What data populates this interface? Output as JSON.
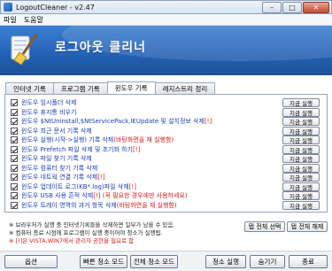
{
  "window": {
    "title": "LogoutCleaner - v2.47"
  },
  "menu": {
    "file": "파일",
    "help": "도움말"
  },
  "banner": {
    "title": "로그아웃 클리너",
    "subtitle": ""
  },
  "tabs": [
    "인터넷 기록",
    "프로그램 기록",
    "윈도우 기록",
    "레지스트리 정리"
  ],
  "rows": [
    {
      "label": "윈도우 임시폴더 삭제",
      "note": "",
      "run": "지금 실행"
    },
    {
      "label": "윈도우 휴지통 비우기",
      "note": "",
      "run": "지금 실행"
    },
    {
      "label": "윈도우 $NtUninstall,$NtServicePack,IEUpdate 및 설치정보 삭제",
      "note": "[!]",
      "run": "지금 실행"
    },
    {
      "label": "윈도우 최근 문서 기록 삭제",
      "note": "",
      "run": "지금 실행"
    },
    {
      "label": "윈도우 실행(시작->실행) 기록 삭제",
      "note": "(바탕화면을 재 실행함)",
      "run": "지금 실행"
    },
    {
      "label": "윈도우 Prefetch 파일 삭제 및 초기화 하기",
      "note": "[!]",
      "run": "지금 실행"
    },
    {
      "label": "윈도우 파일 찾기 기록 삭제",
      "note": "",
      "run": "지금 실행"
    },
    {
      "label": "윈도우 컴퓨터 찾기 기록 삭제",
      "note": "",
      "run": "지금 실행"
    },
    {
      "label": "윈도우 네트웍 연결 기록 삭제",
      "note": "[!]",
      "run": "지금 실행"
    },
    {
      "label": "윈도우 업데이트 로그(KB*.log)파일 삭제",
      "note": "[!]",
      "run": "지금 실행"
    },
    {
      "label": "윈도우 USB 사용 흔적 삭제",
      "note": "[!] (꼭 필요한 경우에만 사용하세요)",
      "run": "지금 실행"
    },
    {
      "label": "윈도우 트레이 영역의 과거 항목 삭제",
      "note": "(바탕화면을 재 실행함)",
      "run": "지금 실행"
    }
  ],
  "notes": [
    "※ 브라우저가 실행 중 인터넷기록들을 삭제하면 일부가 남을 수 있음.",
    "※ 컴퓨터 종료 시점에 프로그램이 실행 중이어야 청소가 실행됨.",
    "※ [!]은 VISTA,WIN7에서 관리자 권한을 필요로 함"
  ],
  "select_buttons": {
    "select_all": "탭 전체 선택",
    "clear_all": "탭 전체 해제"
  },
  "bottom_buttons": {
    "options": "옵션",
    "quick_clean": "빠른 청소 모드",
    "full_clean": "전체 청소 모드",
    "run_clean": "청소 실행",
    "hide": "숨기기",
    "exit": "종료"
  },
  "colors": {
    "accent_blue": "#2563b6",
    "label_blue": "#1a3fb3",
    "warning_red": "#d21b1b"
  }
}
